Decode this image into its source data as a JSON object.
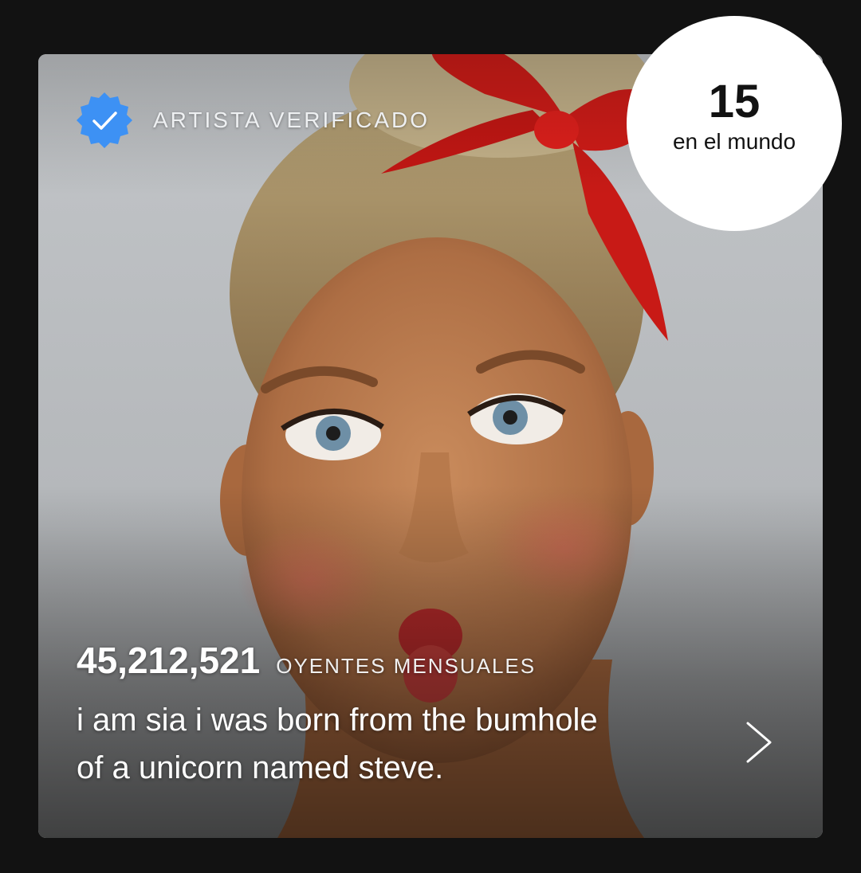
{
  "artist_card": {
    "verified_label": "ARTISTA VERIFICADO",
    "monthly_listeners_count": "45,212,521",
    "monthly_listeners_label": "OYENTES MENSUALES",
    "bio_line_1": "i am sia i was born from the bumhole",
    "bio_line_2": "of a unicorn named steve.",
    "icons": {
      "verified": "verified-badge-icon",
      "more": "chevron-right-icon"
    }
  },
  "world_rank": {
    "number": "15",
    "label": "en el mundo"
  },
  "colors": {
    "background": "#121212",
    "verified_badge": "#3d91f4",
    "ribbon": "#e0201c"
  }
}
